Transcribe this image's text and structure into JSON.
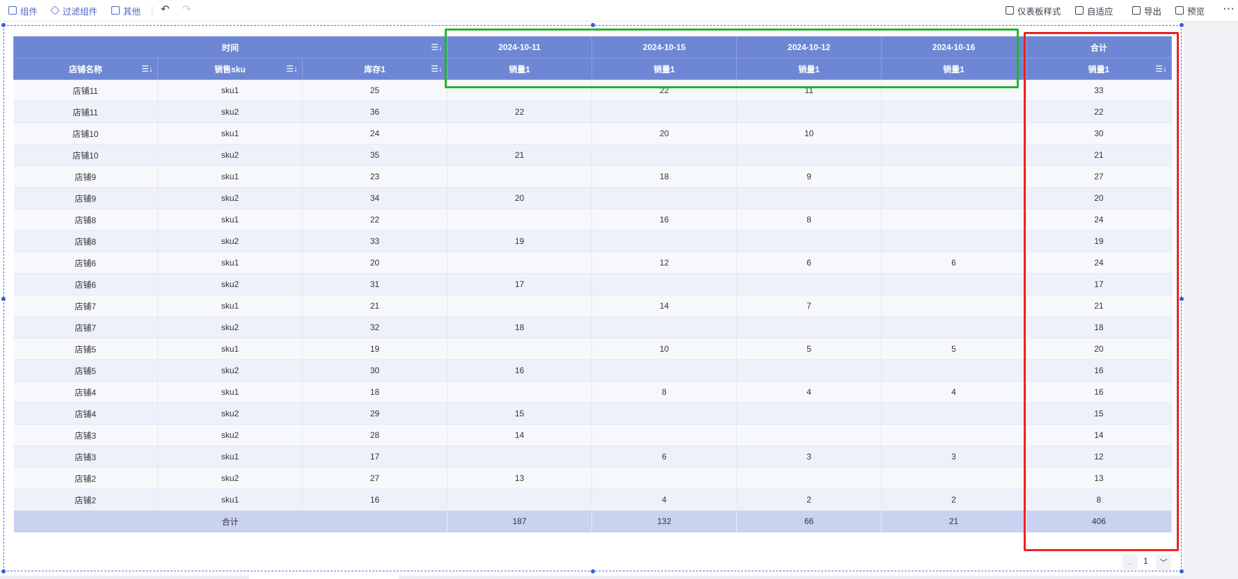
{
  "toolbar": {
    "left": [
      {
        "label": "组件",
        "icon": "component-icon"
      },
      {
        "label": "过滤组件",
        "icon": "filter-cube-icon"
      },
      {
        "label": "其他",
        "icon": "other-icon"
      }
    ],
    "undo_icon": "↶",
    "redo_icon": "↷",
    "right": [
      {
        "label": "仪表板样式",
        "icon": "dashboard-style-icon"
      },
      {
        "label": "自适应",
        "icon": "adaptive-icon"
      },
      {
        "label": "导出",
        "icon": "export-icon"
      },
      {
        "label": "预览",
        "icon": "preview-icon"
      }
    ],
    "more_icon": "⋯"
  },
  "table": {
    "header_top": {
      "time": "时间",
      "dates": [
        "2024-10-11",
        "2024-10-15",
        "2024-10-12",
        "2024-10-16"
      ],
      "total": "合计"
    },
    "header_sub": {
      "store": "店铺名称",
      "sku": "销售sku",
      "stock": "库存1",
      "sales": "销量1"
    },
    "sort_icon": "☰↓",
    "rows": [
      {
        "store": "店铺11",
        "sku": "sku1",
        "stock": "25",
        "d1": "",
        "d2": "22",
        "d3": "11",
        "d4": "",
        "total": "33"
      },
      {
        "store": "店铺11",
        "sku": "sku2",
        "stock": "36",
        "d1": "22",
        "d2": "",
        "d3": "",
        "d4": "",
        "total": "22"
      },
      {
        "store": "店铺10",
        "sku": "sku1",
        "stock": "24",
        "d1": "",
        "d2": "20",
        "d3": "10",
        "d4": "",
        "total": "30"
      },
      {
        "store": "店铺10",
        "sku": "sku2",
        "stock": "35",
        "d1": "21",
        "d2": "",
        "d3": "",
        "d4": "",
        "total": "21"
      },
      {
        "store": "店铺9",
        "sku": "sku1",
        "stock": "23",
        "d1": "",
        "d2": "18",
        "d3": "9",
        "d4": "",
        "total": "27"
      },
      {
        "store": "店铺9",
        "sku": "sku2",
        "stock": "34",
        "d1": "20",
        "d2": "",
        "d3": "",
        "d4": "",
        "total": "20"
      },
      {
        "store": "店铺8",
        "sku": "sku1",
        "stock": "22",
        "d1": "",
        "d2": "16",
        "d3": "8",
        "d4": "",
        "total": "24"
      },
      {
        "store": "店铺8",
        "sku": "sku2",
        "stock": "33",
        "d1": "19",
        "d2": "",
        "d3": "",
        "d4": "",
        "total": "19"
      },
      {
        "store": "店铺6",
        "sku": "sku1",
        "stock": "20",
        "d1": "",
        "d2": "12",
        "d3": "6",
        "d4": "6",
        "total": "24"
      },
      {
        "store": "店铺6",
        "sku": "sku2",
        "stock": "31",
        "d1": "17",
        "d2": "",
        "d3": "",
        "d4": "",
        "total": "17"
      },
      {
        "store": "店铺7",
        "sku": "sku1",
        "stock": "21",
        "d1": "",
        "d2": "14",
        "d3": "7",
        "d4": "",
        "total": "21"
      },
      {
        "store": "店铺7",
        "sku": "sku2",
        "stock": "32",
        "d1": "18",
        "d2": "",
        "d3": "",
        "d4": "",
        "total": "18"
      },
      {
        "store": "店铺5",
        "sku": "sku1",
        "stock": "19",
        "d1": "",
        "d2": "10",
        "d3": "5",
        "d4": "5",
        "total": "20"
      },
      {
        "store": "店铺5",
        "sku": "sku2",
        "stock": "30",
        "d1": "16",
        "d2": "",
        "d3": "",
        "d4": "",
        "total": "16"
      },
      {
        "store": "店铺4",
        "sku": "sku1",
        "stock": "18",
        "d1": "",
        "d2": "8",
        "d3": "4",
        "d4": "4",
        "total": "16"
      },
      {
        "store": "店铺4",
        "sku": "sku2",
        "stock": "29",
        "d1": "15",
        "d2": "",
        "d3": "",
        "d4": "",
        "total": "15"
      },
      {
        "store": "店铺3",
        "sku": "sku2",
        "stock": "28",
        "d1": "14",
        "d2": "",
        "d3": "",
        "d4": "",
        "total": "14"
      },
      {
        "store": "店铺3",
        "sku": "sku1",
        "stock": "17",
        "d1": "",
        "d2": "6",
        "d3": "3",
        "d4": "3",
        "total": "12"
      },
      {
        "store": "店铺2",
        "sku": "sku2",
        "stock": "27",
        "d1": "13",
        "d2": "",
        "d3": "",
        "d4": "",
        "total": "13"
      },
      {
        "store": "店铺2",
        "sku": "sku1",
        "stock": "16",
        "d1": "",
        "d2": "4",
        "d3": "2",
        "d4": "2",
        "total": "8"
      }
    ],
    "footer": {
      "label": "合计",
      "d1": "187",
      "d2": "132",
      "d3": "66",
      "d4": "21",
      "total": "406"
    }
  },
  "pagination": {
    "page": "1",
    "prev_icon": "︿",
    "next_icon": "﹀"
  },
  "colors": {
    "header": "#6d87d4",
    "highlight_green": "#22b52a",
    "highlight_red": "#ee2020",
    "total_row": "#c9d2ee"
  }
}
